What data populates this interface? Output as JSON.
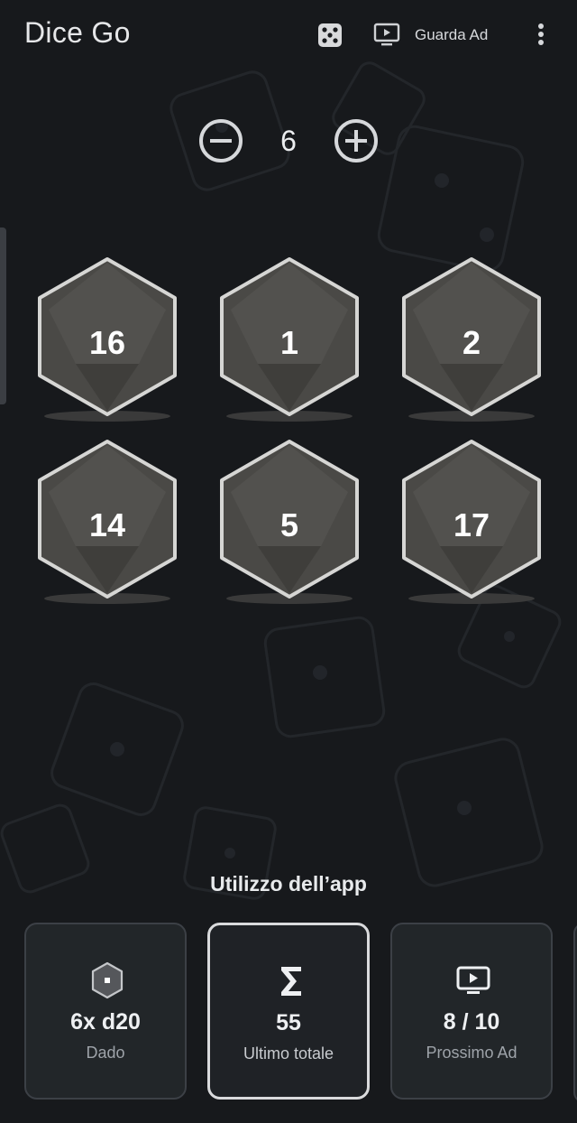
{
  "app_bar": {
    "title": "Dice Go",
    "dice_icon": "dice-five-icon",
    "ad_icon": "tv-play-icon",
    "ad_label": "Guarda Ad",
    "menu_icon": "more-vertical-icon"
  },
  "stepper": {
    "minus_icon": "minus-circle-icon",
    "plus_icon": "plus-circle-icon",
    "count": "6"
  },
  "dice": [
    {
      "type": "d20",
      "value": "16"
    },
    {
      "type": "d20",
      "value": "1"
    },
    {
      "type": "d20",
      "value": "2"
    },
    {
      "type": "d20",
      "value": "14"
    },
    {
      "type": "d20",
      "value": "5"
    },
    {
      "type": "d20",
      "value": "17"
    }
  ],
  "usage": {
    "title": "Utilizzo dell’app",
    "cards": [
      {
        "icon": "d20-hex-icon",
        "value": "6x d20",
        "label": "Dado"
      },
      {
        "icon": "sigma-icon",
        "value": "55",
        "label": "Ultimo totale"
      },
      {
        "icon": "tv-play-icon",
        "value": "8 / 10",
        "label": "Prossimo Ad"
      }
    ]
  },
  "colors": {
    "background": "#17191c",
    "die_face": "#4a4946",
    "die_border": "#d6d6d4",
    "card_bg": "#222629",
    "text_primary": "#e9eaec",
    "text_secondary": "#9ea3a9"
  }
}
